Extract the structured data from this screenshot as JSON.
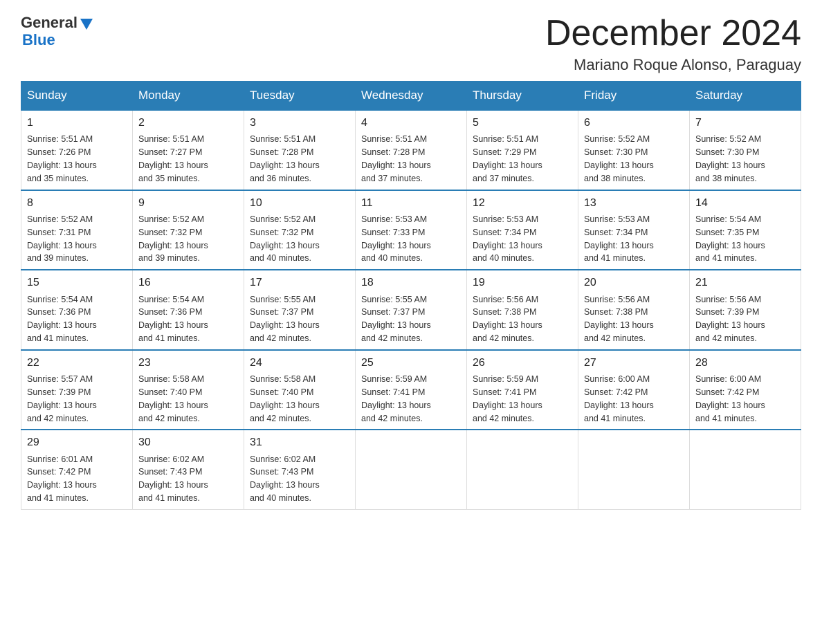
{
  "header": {
    "logo_text_general": "General",
    "logo_text_blue": "Blue",
    "month_year": "December 2024",
    "location": "Mariano Roque Alonso, Paraguay"
  },
  "weekdays": [
    "Sunday",
    "Monday",
    "Tuesday",
    "Wednesday",
    "Thursday",
    "Friday",
    "Saturday"
  ],
  "weeks": [
    [
      {
        "day": "1",
        "sunrise": "5:51 AM",
        "sunset": "7:26 PM",
        "daylight": "13 hours and 35 minutes."
      },
      {
        "day": "2",
        "sunrise": "5:51 AM",
        "sunset": "7:27 PM",
        "daylight": "13 hours and 35 minutes."
      },
      {
        "day": "3",
        "sunrise": "5:51 AM",
        "sunset": "7:28 PM",
        "daylight": "13 hours and 36 minutes."
      },
      {
        "day": "4",
        "sunrise": "5:51 AM",
        "sunset": "7:28 PM",
        "daylight": "13 hours and 37 minutes."
      },
      {
        "day": "5",
        "sunrise": "5:51 AM",
        "sunset": "7:29 PM",
        "daylight": "13 hours and 37 minutes."
      },
      {
        "day": "6",
        "sunrise": "5:52 AM",
        "sunset": "7:30 PM",
        "daylight": "13 hours and 38 minutes."
      },
      {
        "day": "7",
        "sunrise": "5:52 AM",
        "sunset": "7:30 PM",
        "daylight": "13 hours and 38 minutes."
      }
    ],
    [
      {
        "day": "8",
        "sunrise": "5:52 AM",
        "sunset": "7:31 PM",
        "daylight": "13 hours and 39 minutes."
      },
      {
        "day": "9",
        "sunrise": "5:52 AM",
        "sunset": "7:32 PM",
        "daylight": "13 hours and 39 minutes."
      },
      {
        "day": "10",
        "sunrise": "5:52 AM",
        "sunset": "7:32 PM",
        "daylight": "13 hours and 40 minutes."
      },
      {
        "day": "11",
        "sunrise": "5:53 AM",
        "sunset": "7:33 PM",
        "daylight": "13 hours and 40 minutes."
      },
      {
        "day": "12",
        "sunrise": "5:53 AM",
        "sunset": "7:34 PM",
        "daylight": "13 hours and 40 minutes."
      },
      {
        "day": "13",
        "sunrise": "5:53 AM",
        "sunset": "7:34 PM",
        "daylight": "13 hours and 41 minutes."
      },
      {
        "day": "14",
        "sunrise": "5:54 AM",
        "sunset": "7:35 PM",
        "daylight": "13 hours and 41 minutes."
      }
    ],
    [
      {
        "day": "15",
        "sunrise": "5:54 AM",
        "sunset": "7:36 PM",
        "daylight": "13 hours and 41 minutes."
      },
      {
        "day": "16",
        "sunrise": "5:54 AM",
        "sunset": "7:36 PM",
        "daylight": "13 hours and 41 minutes."
      },
      {
        "day": "17",
        "sunrise": "5:55 AM",
        "sunset": "7:37 PM",
        "daylight": "13 hours and 42 minutes."
      },
      {
        "day": "18",
        "sunrise": "5:55 AM",
        "sunset": "7:37 PM",
        "daylight": "13 hours and 42 minutes."
      },
      {
        "day": "19",
        "sunrise": "5:56 AM",
        "sunset": "7:38 PM",
        "daylight": "13 hours and 42 minutes."
      },
      {
        "day": "20",
        "sunrise": "5:56 AM",
        "sunset": "7:38 PM",
        "daylight": "13 hours and 42 minutes."
      },
      {
        "day": "21",
        "sunrise": "5:56 AM",
        "sunset": "7:39 PM",
        "daylight": "13 hours and 42 minutes."
      }
    ],
    [
      {
        "day": "22",
        "sunrise": "5:57 AM",
        "sunset": "7:39 PM",
        "daylight": "13 hours and 42 minutes."
      },
      {
        "day": "23",
        "sunrise": "5:58 AM",
        "sunset": "7:40 PM",
        "daylight": "13 hours and 42 minutes."
      },
      {
        "day": "24",
        "sunrise": "5:58 AM",
        "sunset": "7:40 PM",
        "daylight": "13 hours and 42 minutes."
      },
      {
        "day": "25",
        "sunrise": "5:59 AM",
        "sunset": "7:41 PM",
        "daylight": "13 hours and 42 minutes."
      },
      {
        "day": "26",
        "sunrise": "5:59 AM",
        "sunset": "7:41 PM",
        "daylight": "13 hours and 42 minutes."
      },
      {
        "day": "27",
        "sunrise": "6:00 AM",
        "sunset": "7:42 PM",
        "daylight": "13 hours and 41 minutes."
      },
      {
        "day": "28",
        "sunrise": "6:00 AM",
        "sunset": "7:42 PM",
        "daylight": "13 hours and 41 minutes."
      }
    ],
    [
      {
        "day": "29",
        "sunrise": "6:01 AM",
        "sunset": "7:42 PM",
        "daylight": "13 hours and 41 minutes."
      },
      {
        "day": "30",
        "sunrise": "6:02 AM",
        "sunset": "7:43 PM",
        "daylight": "13 hours and 41 minutes."
      },
      {
        "day": "31",
        "sunrise": "6:02 AM",
        "sunset": "7:43 PM",
        "daylight": "13 hours and 40 minutes."
      },
      null,
      null,
      null,
      null
    ]
  ],
  "labels": {
    "sunrise": "Sunrise:",
    "sunset": "Sunset:",
    "daylight": "Daylight:"
  }
}
